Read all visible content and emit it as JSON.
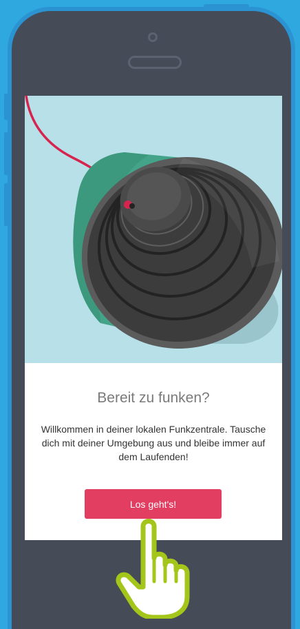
{
  "screen": {
    "headline": "Bereit zu funken?",
    "body": "Willkommen in deiner lokalen Funkzentrale. Tausche dich mit deiner Umgebung aus und bleibe immer auf dem Laufenden!",
    "cta_label": "Los geht's!"
  },
  "colors": {
    "background": "#2fa7df",
    "phone_frame": "#454b57",
    "phone_border": "#2b93d1",
    "illustration_bg": "#b8e0e8",
    "cta": "#e23e62",
    "hand_outline": "#a4c61a"
  },
  "icons": {
    "illustration": "tin-can-phone-illustration",
    "pointer": "pointing-hand-icon"
  }
}
